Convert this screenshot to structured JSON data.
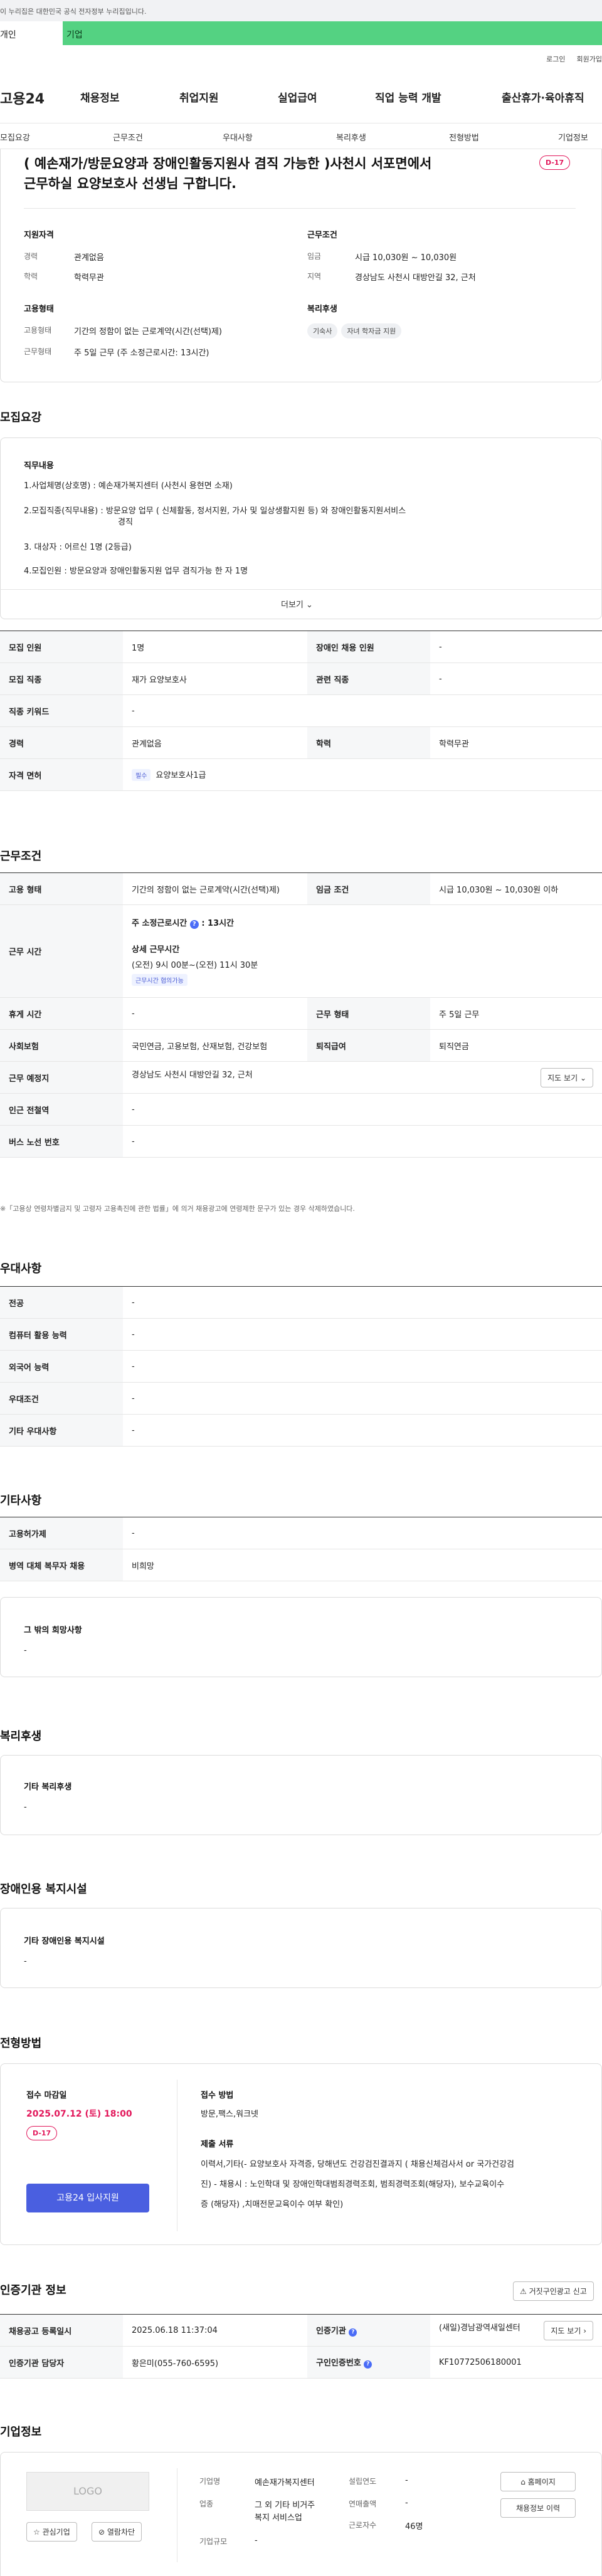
{
  "gov_banner": "이 누리집은 대한민국 공식 전자정부 누리집입니다.",
  "top_tabs": [
    "개인",
    "기업"
  ],
  "util": [
    "로그인",
    "회원가입"
  ],
  "logo": "고용24",
  "gnb": [
    "채용정보",
    "취업지원",
    "실업급여",
    "직업 능력 개발",
    "출산휴가·육아휴직"
  ],
  "subnav": [
    "모집요강",
    "근무조건",
    "우대사항",
    "복리후생",
    "전형방법",
    "기업정보"
  ],
  "header": {
    "title_l1": "( 예손재가/방문요양과 장애인활동지원사 겸직 가능한 )사천시 서포면에서",
    "title_l2": "근무하실 요양보호사 선생님 구합니다.",
    "dday": "D-17",
    "qual_title": "지원자격",
    "cond_title": "근무조건",
    "exp_k": "경력",
    "exp_v": "관계없음",
    "edu_k": "학력",
    "edu_v": "학력무관",
    "wage_k": "임금",
    "wage_v": "시급 10,030원 ~ 10,030원",
    "area_k": "지역",
    "area_v": "경상남도 사천시 대방안길 32, 근처",
    "emp_title": "고용형태",
    "welfare_title": "복리후생",
    "emp_k": "고용형태",
    "emp_v": "기간의 정함이 없는 근로계약(시간(선택)제)",
    "work_k": "근무형태",
    "work_v": "주 5일 근무 (주 소정근로시간: 13시간)",
    "chips": [
      "기숙사",
      "자녀 학자금 지원"
    ]
  },
  "recruit": {
    "section": "모집요강",
    "duty_title": "직무내용",
    "lines": [
      "1.사업체명(상호명) : 예손재가복지센터 (사천시 용현면 소재)",
      "2.모집직종(직무내용) : 방문요양 업무 ( 신체활동, 정서지원, 가사 및 일상생활지원 등) 와 장애인활동지원서비스",
      "경직",
      "3. 대상자 : 어르신 1명 (2등급)",
      "4.모집인원 : 방문요양과 장애인활동지원 업무  겸직가능 한 자  1명"
    ],
    "more": "더보기",
    "rows": [
      [
        "모집 인원",
        "1명",
        "장애인 채용 인원",
        "-"
      ],
      [
        "모집 직종",
        "재가 요양보호사",
        "관련 직종",
        "-"
      ],
      [
        "직종 키워드",
        "-"
      ],
      [
        "경력",
        "관계없음",
        "학력",
        "학력무관"
      ],
      [
        "자격 면허",
        "필수",
        "요양보호사1급"
      ]
    ]
  },
  "cond": {
    "section": "근무조건",
    "emp_k": "고용 형태",
    "emp_v": "기간의 정함이 없는 근로계약(시간(선택)제)",
    "wage_k": "임금 조건",
    "wage_v": "시급 10,030원 ~ 10,030원 이하",
    "time_k": "근무 시간",
    "weekly": "주 소정근로시간",
    "weekly_v": ": 13시간",
    "detail": "상세 근무시간",
    "detail_v": "(오전) 9시 00분~(오전) 11시 30분",
    "badge": "근무시간 협의가능",
    "holiday_k": "휴게 시간",
    "holiday_v": "-",
    "type_k": "근무 형태",
    "type_v": "주 5일 근무",
    "ins_k": "사회보험",
    "ins_v": "국민연금, 고용보험, 산재보험, 건강보험",
    "ret_k": "퇴직급여",
    "ret_v": "퇴직연금",
    "place_k": "근무 예정지",
    "place_v": "경상남도 사천시 대방안길 32, 근처",
    "map": "지도 보기",
    "sub_k": "인근 전철역",
    "sub_v": "-",
    "bus_k": "버스 노선 번호",
    "bus_v": "-",
    "note": "※「고용상 연령차별금지 및 고령자 고용촉진에 관한 법률」에 의거 채용광고에 연령제한 문구가 있는 경우 삭제하였습니다."
  },
  "pref": {
    "section": "우대사항",
    "rows": [
      [
        "전공",
        "-"
      ],
      [
        "컴퓨터 활용 능력",
        "-"
      ],
      [
        "외국어 능력",
        "-"
      ],
      [
        "우대조건",
        "-"
      ],
      [
        "기타 우대사항",
        "-"
      ]
    ]
  },
  "etc": {
    "section": "기타사항",
    "rows": [
      [
        "고용허가제",
        "-"
      ],
      [
        "병역 대체 복무자 채용",
        "비희망"
      ]
    ],
    "wish_title": "그 밖의 희망사항",
    "wish_v": "-"
  },
  "welfare": {
    "section": "복리후생",
    "label": "기타 복리후생",
    "value": "-"
  },
  "disab": {
    "section": "장애인용 복지시설",
    "label": "기타 장애인용 복지시설",
    "value": "-"
  },
  "process": {
    "section": "전형방법",
    "deadline_k": "접수 마감일",
    "deadline_v": "2025.07.12 (토) 18:00",
    "dday": "D-17",
    "apply": "고용24 입사지원",
    "method_k": "접수 방법",
    "method_v": "방문,팩스,워크넷",
    "docs_k": "제출 서류",
    "docs": [
      "이력서,기타(-   요양보호사 자격증, 당해년도 건강검진결과지 ( 채용신체검사서 or 국가건강검",
      "진)   -   채용시 : 노인학대 및 장애인학대범죄경력조회, 범죄경력조회(해당자), 보수교육이수",
      "증 (해당자) ,치매전문교육이수 여부 확인)"
    ]
  },
  "cert": {
    "section": "인증기관 정보",
    "report": "거짓구인광고 신고",
    "r1": [
      "채용공고 등록일시",
      "2025.06.18 11:37:04",
      "인증기관",
      "(새일)경남광역새일센터",
      "지도 보기"
    ],
    "r2": [
      "인증기관 담당자",
      "황은미(055-760-6595)",
      "구인인증번호",
      "KF10772506180001"
    ]
  },
  "company": {
    "section": "기업정보",
    "logo": "LOGO",
    "fav": "관심기업",
    "block": "열람차단",
    "name_k": "기업명",
    "name_v": "예손재가복지센터",
    "ind_k": "업종",
    "ind_v1": "그 외 기타 비거주",
    "ind_v2": "복지 서비스업",
    "size_k": "기업규모",
    "size_v": "-",
    "est_k": "설립연도",
    "est_v": "-",
    "sales_k": "연매출액",
    "sales_v": "-",
    "emp_k": "근로자수",
    "emp_v": "46명",
    "home": "홈페이지",
    "history": "채용정보 이력"
  }
}
